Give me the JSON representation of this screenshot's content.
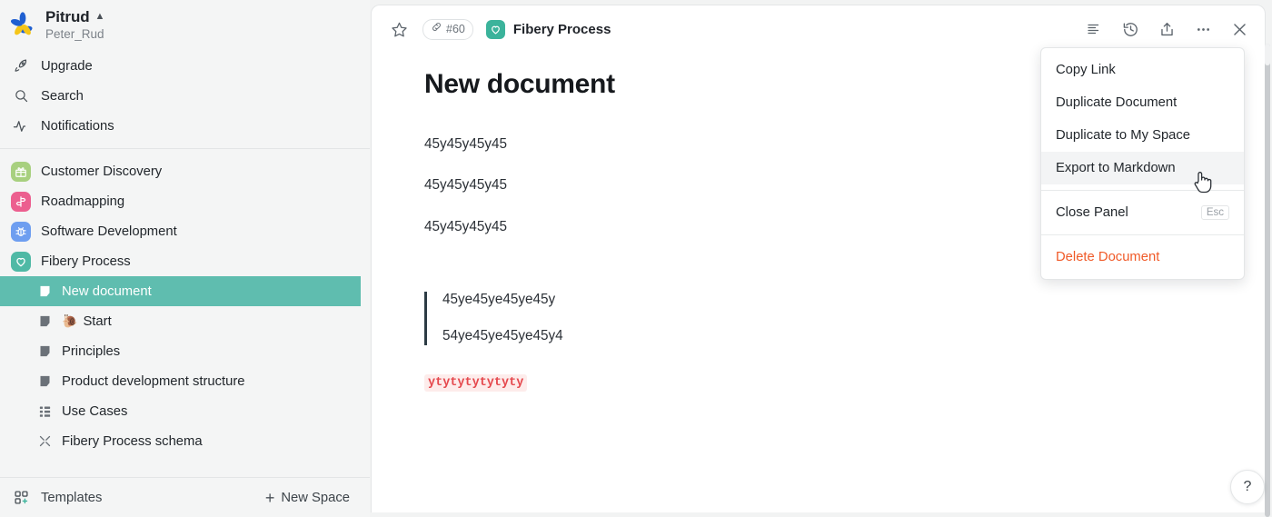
{
  "workspace": {
    "name": "Pitrud",
    "user": "Peter_Rud",
    "logo_icon": "fibery-pinwheel-logo",
    "caret_icon": "chevron-up-icon"
  },
  "sidebar": {
    "nav": [
      {
        "label": "Upgrade",
        "icon": "rocket-icon"
      },
      {
        "label": "Search",
        "icon": "search-icon"
      },
      {
        "label": "Notifications",
        "icon": "activity-pulse-icon"
      }
    ],
    "spaces": [
      {
        "label": "Customer Discovery",
        "icon": "gift-icon",
        "color": "#a8d07f"
      },
      {
        "label": "Roadmapping",
        "icon": "signpost-icon",
        "color": "#ec5f8f"
      },
      {
        "label": "Software Development",
        "icon": "bug-icon",
        "color": "#6e9ef0"
      },
      {
        "label": "Fibery Process",
        "icon": "heart-icon",
        "color": "#4fb9a5"
      }
    ],
    "documents": [
      {
        "label": "New document",
        "icon": "document-icon",
        "emoji": "",
        "selected": true
      },
      {
        "label": "Start",
        "icon": "document-icon",
        "emoji": "🐌",
        "selected": false
      },
      {
        "label": "Principles",
        "icon": "document-icon",
        "emoji": "",
        "selected": false
      },
      {
        "label": "Product development structure",
        "icon": "document-icon",
        "emoji": "",
        "selected": false
      },
      {
        "label": "Use Cases",
        "icon": "grid-list-icon",
        "emoji": "",
        "selected": false
      },
      {
        "label": "Fibery Process schema",
        "icon": "schema-scatter-icon",
        "emoji": "",
        "selected": false
      }
    ],
    "footer": {
      "templates_label": "Templates",
      "templates_icon": "templates-grid-icon",
      "new_space_label": "New Space",
      "new_space_icon": "plus-icon"
    },
    "selected_color": "#5fbdaf"
  },
  "panel": {
    "toolbar": {
      "star_icon": "star-outline-icon",
      "ref_badge": {
        "icon": "link-chain-icon",
        "value": "#60"
      },
      "breadcrumb_space": "Fibery Process",
      "breadcrumb_icon": "heart-icon",
      "right_icons": [
        {
          "name": "outline-list-icon"
        },
        {
          "name": "history-clock-icon"
        },
        {
          "name": "share-upload-icon"
        },
        {
          "name": "more-ellipsis-icon"
        },
        {
          "name": "close-x-icon"
        }
      ]
    },
    "document": {
      "title": "New document",
      "paragraphs": [
        "45y45y45y45",
        "45y45y45y45",
        "45y45y45y45"
      ],
      "blockquote": [
        "45ye45ye45ye45y",
        "54ye45ye45ye45y4"
      ],
      "code_text": "ytytytytytyty",
      "code_color": "#e5484d",
      "code_background": "#fdeceb"
    }
  },
  "menu": {
    "items": [
      {
        "label": "Copy Link",
        "hovered": false,
        "danger": false,
        "shortcut": ""
      },
      {
        "label": "Duplicate Document",
        "hovered": false,
        "danger": false,
        "shortcut": ""
      },
      {
        "label": "Duplicate to My Space",
        "hovered": false,
        "danger": false,
        "shortcut": ""
      },
      {
        "label": "Export to Markdown",
        "hovered": true,
        "danger": false,
        "shortcut": ""
      },
      {
        "label": "Close Panel",
        "hovered": false,
        "danger": false,
        "shortcut": "Esc"
      },
      {
        "label": "Delete Document",
        "hovered": false,
        "danger": true,
        "shortcut": ""
      }
    ],
    "danger_color": "#f05a28"
  },
  "help": {
    "label": "?"
  }
}
